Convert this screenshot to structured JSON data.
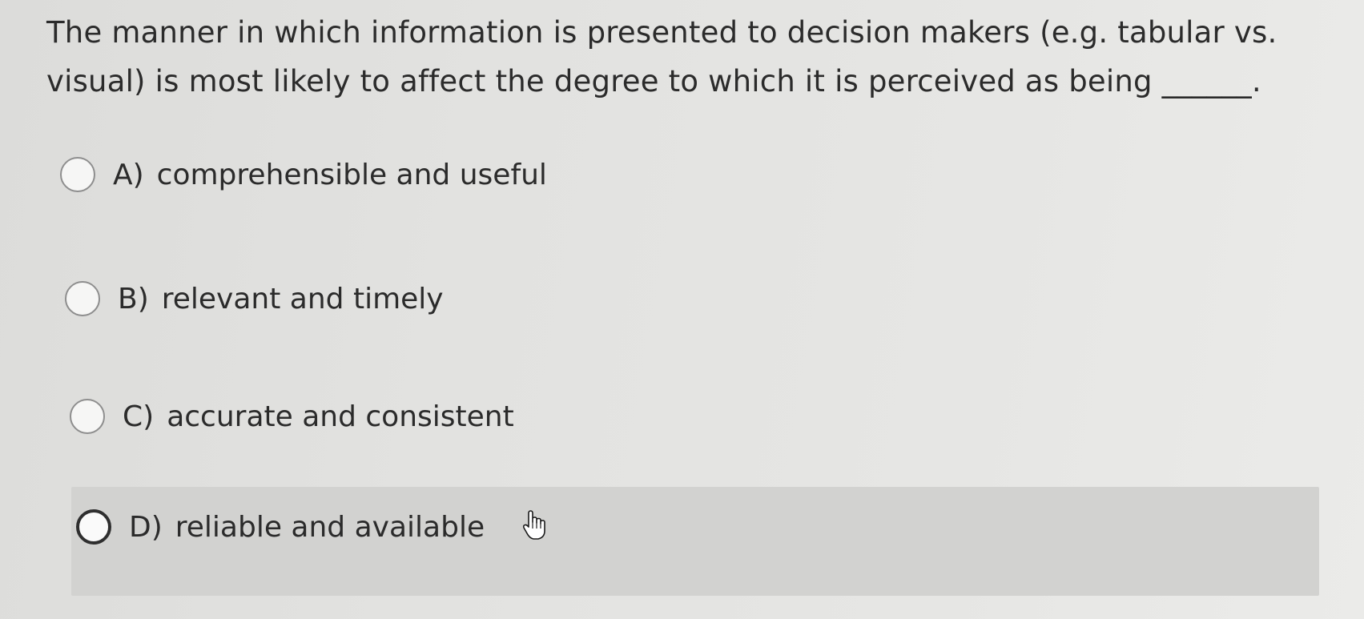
{
  "question": {
    "text": "The manner in which information is presented to decision makers (e.g. tabular vs. visual) is most likely to affect the degree to which it is perceived as being ______."
  },
  "options": [
    {
      "letter": "A)",
      "text": "comprehensible and useful"
    },
    {
      "letter": "B)",
      "text": "relevant and timely"
    },
    {
      "letter": "C)",
      "text": "accurate and consistent"
    },
    {
      "letter": "D)",
      "text": "reliable and available"
    }
  ],
  "state": {
    "hovered_option": "D)",
    "selected_option": null
  },
  "icons": {
    "radio": "radio-button-icon",
    "cursor": "hand-pointer-icon"
  },
  "colors": {
    "background": "#e4e4e2",
    "hover_highlight": "#d2d2d0",
    "text": "#2b2b2b"
  }
}
